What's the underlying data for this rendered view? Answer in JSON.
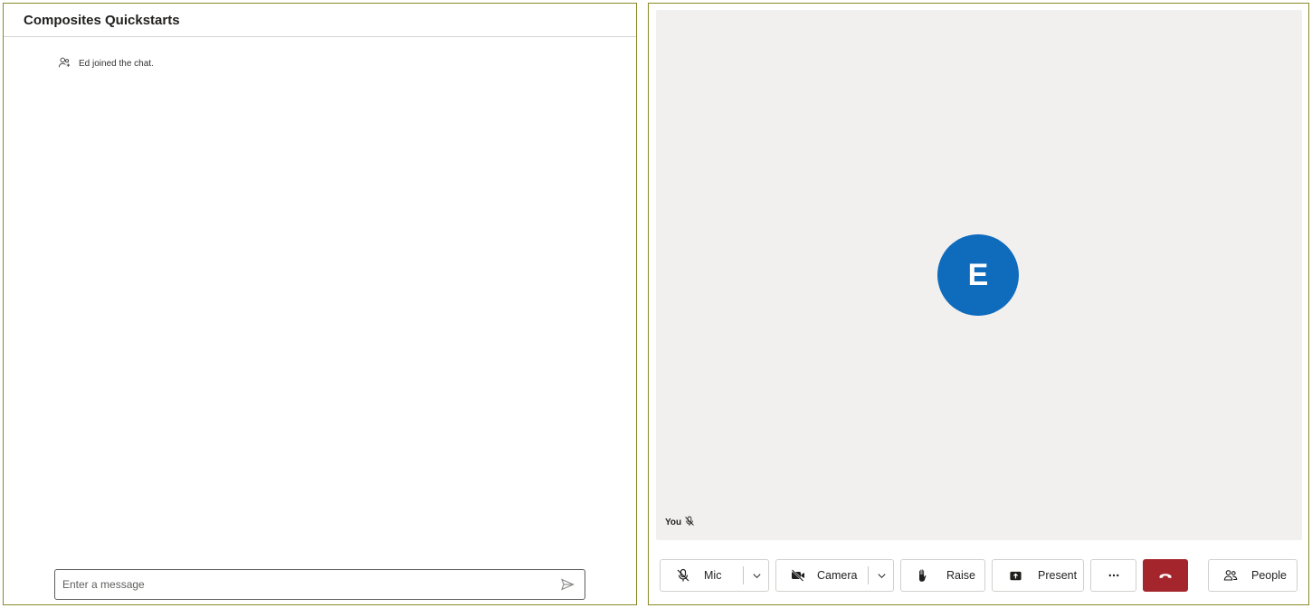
{
  "chat": {
    "title": "Composites Quickstarts",
    "system_message": "Ed joined the chat.",
    "composer_placeholder": "Enter a message"
  },
  "call": {
    "avatar_initial": "E",
    "tile_label": "You",
    "controls": {
      "mic": "Mic",
      "camera": "Camera",
      "raise": "Raise",
      "present": "Present",
      "people": "People"
    },
    "icons": {
      "mic": "mic-off-icon",
      "camera": "camera-off-icon",
      "raise": "hand-icon",
      "present": "share-screen-icon",
      "more": "more-horizontal-icon",
      "hangup": "call-end-icon",
      "people": "people-icon",
      "send": "send-icon",
      "participant": "person-add-icon"
    },
    "colors": {
      "avatar": "#0f6cbd",
      "hangup": "#a4262c",
      "stage": "#f1f0ef"
    }
  }
}
